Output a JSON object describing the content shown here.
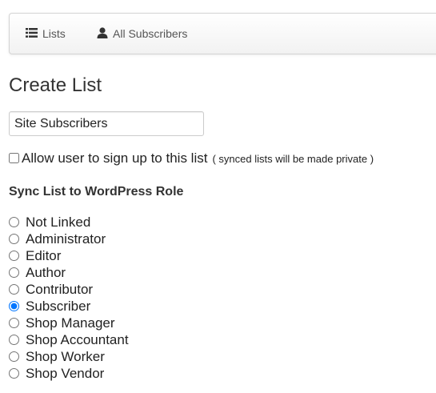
{
  "nav": {
    "lists_label": "Lists",
    "subscribers_label": "All Subscribers",
    "lists_icon": "list-icon",
    "subscribers_icon": "user-icon"
  },
  "page_title": "Create List",
  "list_name": {
    "value": "Site Subscribers",
    "placeholder": ""
  },
  "signup": {
    "label": "Allow user to sign up to this list",
    "note": "( synced lists will be made private )",
    "checked": false
  },
  "sync_heading": "Sync List to WordPress Role",
  "roles": [
    {
      "label": "Not Linked",
      "selected": false
    },
    {
      "label": "Administrator",
      "selected": false
    },
    {
      "label": "Editor",
      "selected": false
    },
    {
      "label": "Author",
      "selected": false
    },
    {
      "label": "Contributor",
      "selected": false
    },
    {
      "label": "Subscriber",
      "selected": true
    },
    {
      "label": "Shop Manager",
      "selected": false
    },
    {
      "label": "Shop Accountant",
      "selected": false
    },
    {
      "label": "Shop Worker",
      "selected": false
    },
    {
      "label": "Shop Vendor",
      "selected": false
    }
  ],
  "colors": {
    "text": "#333333",
    "nav_border": "#d4d4d4",
    "nav_bg": "#f2f2f2"
  }
}
